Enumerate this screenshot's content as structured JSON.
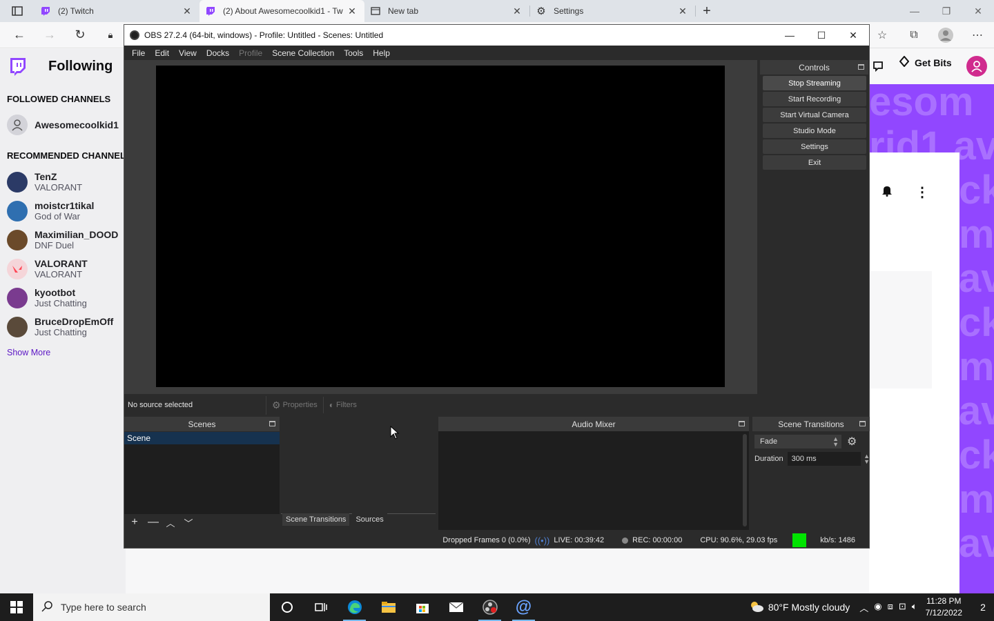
{
  "browser": {
    "tabs": [
      {
        "title": "(2) Twitch",
        "active": false
      },
      {
        "title": "(2) About Awesomecoolkid1 - Tw",
        "active": true
      },
      {
        "title": "New tab",
        "active": false
      },
      {
        "title": "Settings",
        "active": false
      }
    ],
    "newtab_label": "+"
  },
  "twitch": {
    "following": "Following",
    "followed_header": "FOLLOWED CHANNELS",
    "followed": [
      {
        "name": "Awesomecoolkid1"
      }
    ],
    "recommended_header": "RECOMMENDED CHANNELS",
    "recommended": [
      {
        "name": "TenZ",
        "game": "VALORANT",
        "color": "#2b3a66"
      },
      {
        "name": "moistcr1tikal",
        "game": "God of War",
        "color": "#2f6fb0"
      },
      {
        "name": "Maximilian_DOOD",
        "game": "DNF Duel",
        "color": "#6b4a2a"
      },
      {
        "name": "VALORANT",
        "game": "VALORANT",
        "color": "#f5d5d9"
      },
      {
        "name": "kyootbot",
        "game": "Just Chatting",
        "color": "#7a3b8f"
      },
      {
        "name": "BruceDropEmOff",
        "game": "Just Chatting",
        "color": "#5a4a3a"
      }
    ],
    "show_more": "Show More",
    "get_bits": "Get Bits",
    "brand_color": "#9147ff",
    "watermark": [
      "esom",
      "rid1 av",
      "cki",
      "me",
      "av",
      "cki",
      "me",
      "av",
      "cki",
      "me",
      "av"
    ]
  },
  "obs": {
    "title": "OBS 27.2.4 (64-bit, windows) - Profile: Untitled - Scenes: Untitled",
    "menu": [
      "File",
      "Edit",
      "View",
      "Docks",
      "Profile",
      "Scene Collection",
      "Tools",
      "Help"
    ],
    "controls": {
      "header": "Controls",
      "buttons": [
        "Stop Streaming",
        "Start Recording",
        "Start Virtual Camera",
        "Studio Mode",
        "Settings",
        "Exit"
      ]
    },
    "source_toolbar": {
      "no_source": "No source selected",
      "properties": "Properties",
      "filters": "Filters"
    },
    "scenes": {
      "header": "Scenes",
      "items": [
        "Scene"
      ]
    },
    "mid_tabs": [
      "Scene Transitions",
      "Sources"
    ],
    "mixer": {
      "header": "Audio Mixer"
    },
    "transitions": {
      "header": "Scene Transitions",
      "selected": "Fade",
      "duration_label": "Duration",
      "duration_value": "300 ms"
    },
    "status": {
      "dropped": "Dropped Frames 0 (0.0%)",
      "live": "LIVE: 00:39:42",
      "rec": "REC: 00:00:00",
      "cpu": "CPU: 90.6%, 29.03 fps",
      "kbs": "kb/s: 1486"
    }
  },
  "taskbar": {
    "search_placeholder": "Type here to search",
    "weather": "80°F  Mostly cloudy",
    "time": "11:28 PM",
    "date": "7/12/2022",
    "notifications": "2"
  }
}
